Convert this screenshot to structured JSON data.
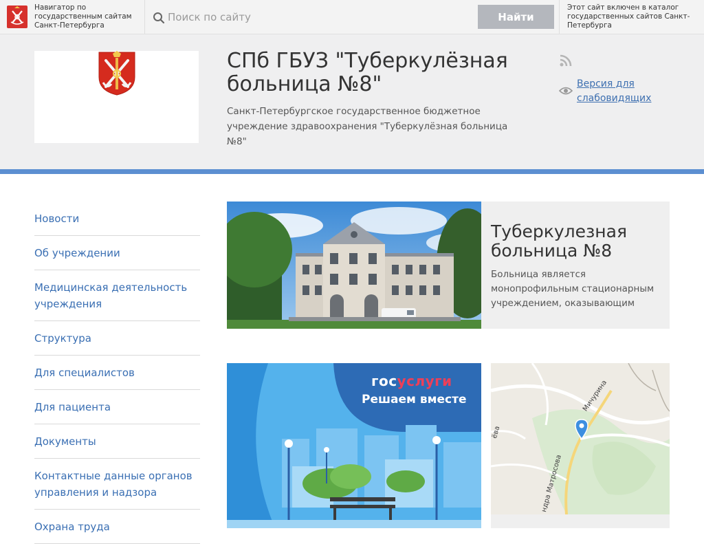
{
  "topbar": {
    "navigator_text": "Навигатор по государственным сайтам Санкт-Петербурга",
    "search_placeholder": "Поиск по сайту",
    "search_button": "Найти",
    "catalog_text": "Этот сайт включен в каталог государственных сайтов Санкт-Петербурга"
  },
  "header": {
    "title": "СПб ГБУЗ \"Туберкулёзная больница №8\"",
    "subtitle": "Санкт-Петербургское государственное бюджетное учреждение здравоохранения \"Туберкулёзная больница №8\"",
    "low_vision_link": "Версия для слабовидящих"
  },
  "sidebar": {
    "items": [
      {
        "label": "Новости"
      },
      {
        "label": "Об учреждении"
      },
      {
        "label": "Медицинская деятельность учреждения"
      },
      {
        "label": "Структура"
      },
      {
        "label": "Для специалистов"
      },
      {
        "label": "Для пациента"
      },
      {
        "label": "Документы"
      },
      {
        "label": "Контактные данные органов управления и надзора"
      },
      {
        "label": "Охрана труда"
      }
    ]
  },
  "feature": {
    "title": "Туберкулезная больница №8",
    "text": "Больница является монопрофильным стационарным учреждением, оказывающим"
  },
  "banner": {
    "brand_part1": "гос",
    "brand_part2": "услуги",
    "tagline": "Решаем вместе"
  },
  "map": {
    "label_street1": "Мичурина",
    "label_street2": "ндра Матросова",
    "label_left": "ёва"
  },
  "colors": {
    "accent_blue": "#5c8fd1",
    "link_blue": "#3a6fb3",
    "gos_red": "#ee3f58",
    "gos_blue": "#2d6bb5"
  }
}
